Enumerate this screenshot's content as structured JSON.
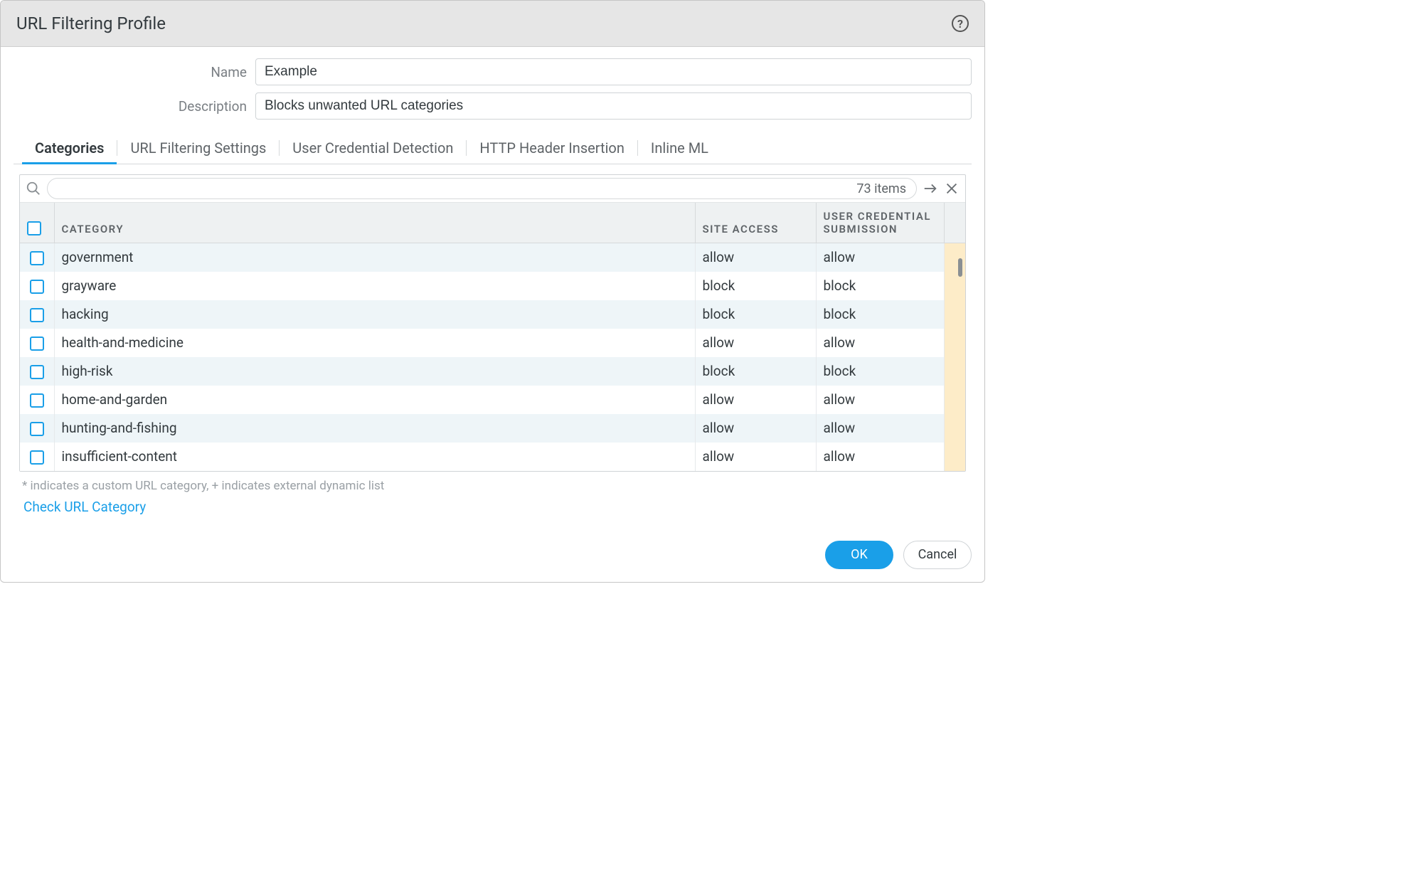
{
  "dialog": {
    "title": "URL Filtering Profile"
  },
  "form": {
    "name_label": "Name",
    "name_value": "Example",
    "description_label": "Description",
    "description_value": "Blocks unwanted URL categories"
  },
  "tabs": [
    {
      "id": "categories",
      "label": "Categories",
      "active": true
    },
    {
      "id": "url-filtering-settings",
      "label": "URL Filtering Settings",
      "active": false
    },
    {
      "id": "user-credential-detection",
      "label": "User Credential Detection",
      "active": false
    },
    {
      "id": "http-header-insertion",
      "label": "HTTP Header Insertion",
      "active": false
    },
    {
      "id": "inline-ml",
      "label": "Inline ML",
      "active": false
    }
  ],
  "search": {
    "item_count_label": "73 items"
  },
  "table": {
    "columns": {
      "category": "CATEGORY",
      "site_access": "SITE ACCESS",
      "user_credential_submission": "USER CREDENTIAL SUBMISSION"
    },
    "rows": [
      {
        "category": "government",
        "site_access": "allow",
        "user_credential_submission": "allow"
      },
      {
        "category": "grayware",
        "site_access": "block",
        "user_credential_submission": "block"
      },
      {
        "category": "hacking",
        "site_access": "block",
        "user_credential_submission": "block"
      },
      {
        "category": "health-and-medicine",
        "site_access": "allow",
        "user_credential_submission": "allow"
      },
      {
        "category": "high-risk",
        "site_access": "block",
        "user_credential_submission": "block"
      },
      {
        "category": "home-and-garden",
        "site_access": "allow",
        "user_credential_submission": "allow"
      },
      {
        "category": "hunting-and-fishing",
        "site_access": "allow",
        "user_credential_submission": "allow"
      },
      {
        "category": "insufficient-content",
        "site_access": "allow",
        "user_credential_submission": "allow"
      }
    ]
  },
  "footnote": "* indicates a custom URL category, + indicates external dynamic list",
  "link_text": "Check URL Category",
  "buttons": {
    "ok": "OK",
    "cancel": "Cancel"
  }
}
